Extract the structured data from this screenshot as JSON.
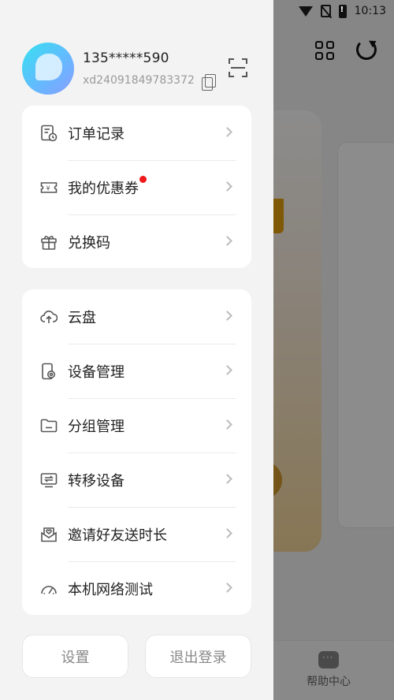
{
  "status_bar": {
    "time": "10:13"
  },
  "profile": {
    "phone": "135*****590",
    "user_id": "xd24091849783372"
  },
  "menu_group_1": [
    {
      "label": "订单记录",
      "icon": "order-record-icon"
    },
    {
      "label": "我的优惠券",
      "icon": "coupon-icon",
      "has_red_dot": true
    },
    {
      "label": "兑换码",
      "icon": "gift-icon"
    }
  ],
  "menu_group_2": [
    {
      "label": "云盘",
      "icon": "cloud-upload-icon"
    },
    {
      "label": "设备管理",
      "icon": "device-settings-icon"
    },
    {
      "label": "分组管理",
      "icon": "folder-icon"
    },
    {
      "label": "转移设备",
      "icon": "transfer-device-icon"
    },
    {
      "label": "邀请好友送时长",
      "icon": "invite-envelope-icon"
    },
    {
      "label": "本机网络测试",
      "icon": "speedometer-icon"
    }
  ],
  "buttons": {
    "settings": "设置",
    "logout": "退出登录"
  },
  "background_app": {
    "help_tab_label": "帮助中心"
  },
  "colors": {
    "red_dot": "#f01818",
    "drawer_bg": "#f3f3f3",
    "avatar_accent": "#36e0f0"
  }
}
